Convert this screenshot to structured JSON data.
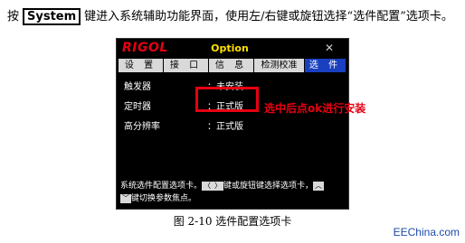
{
  "intro": {
    "before": "按",
    "key_label": "System",
    "after": "键进入系统辅助功能界面，使用左/右键或旋钮选择“选件配置”选项卡。"
  },
  "screen": {
    "logo": "RIGOL",
    "title": "Option",
    "status_icon": "✕",
    "tabs": [
      {
        "label": "设 置",
        "active": false
      },
      {
        "label": "接 口",
        "active": false
      },
      {
        "label": "信 息",
        "active": false
      },
      {
        "label": "检测校准",
        "active": false
      },
      {
        "label": "选 件",
        "active": true
      }
    ],
    "rows": [
      {
        "label": "触发器",
        "value": "：未安装"
      },
      {
        "label": "定时器",
        "value": "：正式版"
      },
      {
        "label": "高分辨率",
        "value": "：正式版"
      }
    ],
    "help": {
      "text1": "系统选件配置选项卡。",
      "left_key": "〈",
      "right_key": "〉",
      "text2": "键或旋钮键选择选项卡，",
      "up_key": "︿",
      "down_key": "﹀",
      "text3": "键切换参数焦点。"
    }
  },
  "annotation": "选中后点ok进行安装",
  "caption": "图 2-10 选件配置选项卡",
  "watermark": "EEChina.com",
  "colors": {
    "accent_red": "#e60012",
    "title_yellow": "#ffe000",
    "active_tab": "#1a3fbf"
  }
}
